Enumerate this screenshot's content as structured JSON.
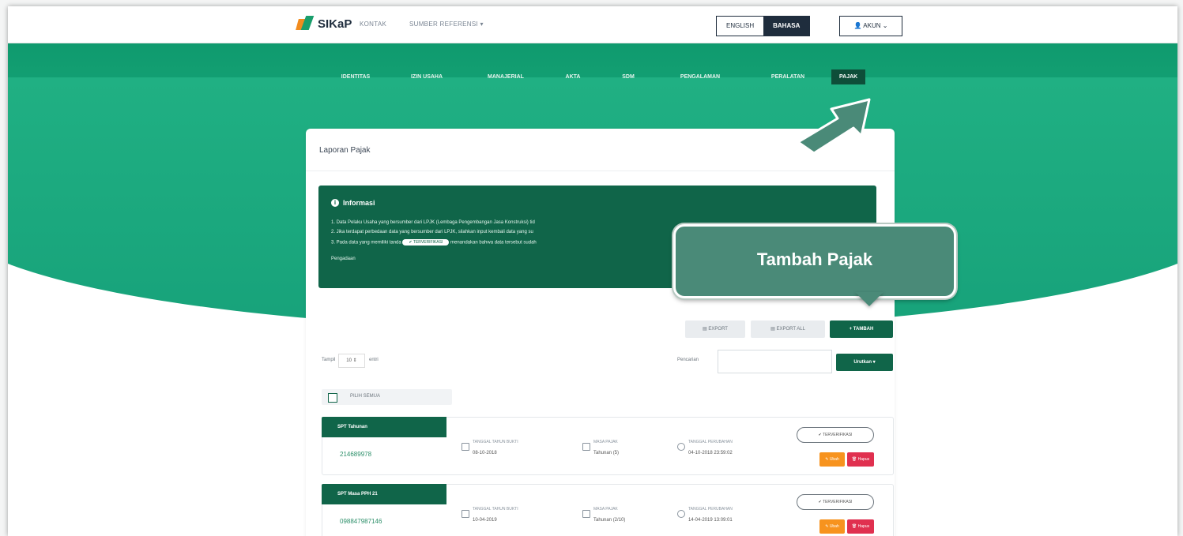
{
  "topbar": {
    "logo_text": "SIKaP",
    "nav": [
      "KONTAK",
      "SUMBER REFERENSI ▾"
    ],
    "lang": [
      "ENGLISH",
      "BAHASA"
    ],
    "akun_label": "AKUN"
  },
  "tabs": [
    "IDENTITAS",
    "IZIN USAHA",
    "MANAJERIAL",
    "AKTA",
    "SDM",
    "PENGALAMAN",
    "PERALATAN",
    "PAJAK"
  ],
  "panel": {
    "title": "Laporan Pajak",
    "info": {
      "heading": "Informasi",
      "line1": "1. Data Pelaku Usaha yang bersumber dari LPJK (Lembaga Pengembangan Jasa Konstruksi) tid",
      "line2": "2. Jika terdapat perbedaan data yang bersumber dari LPJK, silahkan input kembali data yang su",
      "line3a": "3. Pada data yang memiliki tanda",
      "line3_pill": "TERVERIFIKASI",
      "line3b": "menandakan bahwa data tersebut sudah",
      "line4": "Pengadaan"
    },
    "buttons": {
      "export": "EXPORT",
      "export_all": "EXPORT ALL",
      "tambah": "TAMBAH"
    },
    "controls": {
      "show_label": "Tampil",
      "show_value": "10",
      "entries_label": "entri",
      "search_label": "Pencarian",
      "sort_label": "Urutkan"
    },
    "select_all": "PILIH SEMUA",
    "cards": [
      {
        "title": "SPT Tahunan",
        "number": "214689978",
        "f1_label": "TANGGAL TAHUN BUKTI",
        "f1_value": "08-10-2018",
        "f2_label": "MASA PAJAK",
        "f2_value": "Tahunan (5)",
        "f3_label": "TANGGAL PERUBAHAN",
        "f3_value": "04-10-2018 23:59:02",
        "badge": "TERVERIFIKASI",
        "edit": "Ubah",
        "delete": "Hapus"
      },
      {
        "title": "SPT Masa PPH 21",
        "number": "098847987146",
        "f1_label": "TANGGAL TAHUN BUKTI",
        "f1_value": "10-04-2019",
        "f2_label": "MASA PAJAK",
        "f2_value": "Tahunan (2/10)",
        "f3_label": "TANGGAL PERUBAHAN",
        "f3_value": "14-04-2019 13:09:01",
        "badge": "TERVERIFIKASI",
        "edit": "Ubah",
        "delete": "Hapus"
      }
    ]
  },
  "callout": {
    "text": "Tambah Pajak"
  },
  "colors": {
    "primary": "#106549",
    "hero": "#1aa97a",
    "callout": "#4a8a78",
    "edit": "#f7931e",
    "delete": "#e0304f"
  }
}
